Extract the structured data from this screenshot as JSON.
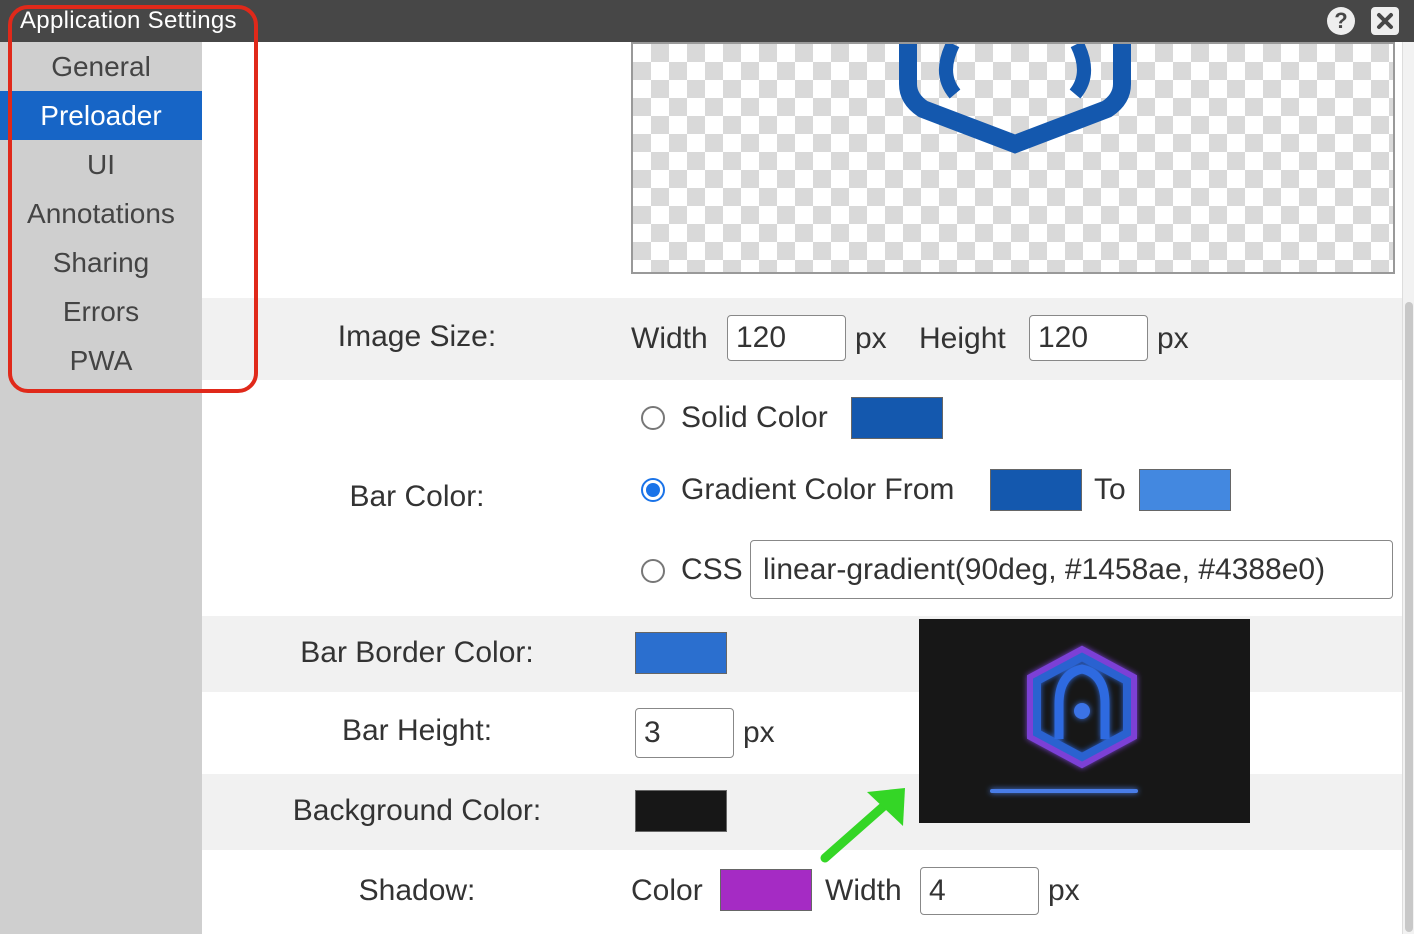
{
  "window": {
    "title": "Application Settings",
    "help_icon": "question-icon",
    "close_icon": "close-icon"
  },
  "sidebar": {
    "items": [
      {
        "label": "General",
        "active": false
      },
      {
        "label": "Preloader",
        "active": true
      },
      {
        "label": "UI",
        "active": false
      },
      {
        "label": "Annotations",
        "active": false
      },
      {
        "label": "Sharing",
        "active": false
      },
      {
        "label": "Errors",
        "active": false
      },
      {
        "label": "PWA",
        "active": false
      }
    ]
  },
  "preloader": {
    "image_size": {
      "label": "Image Size:",
      "width_label": "Width",
      "width_value": "120",
      "height_label": "Height",
      "height_value": "120",
      "unit": "px"
    },
    "bar_color": {
      "label": "Bar Color:",
      "solid_label": "Solid Color",
      "solid_color": "#1458ae",
      "gradient_label": "Gradient Color From",
      "gradient_from": "#1458ae",
      "to_label": "To",
      "gradient_to": "#4388e0",
      "css_label": "CSS",
      "css_value": "linear-gradient(90deg, #1458ae, #4388e0)",
      "selected": "gradient"
    },
    "bar_border_color": {
      "label": "Bar Border Color:",
      "color": "#2b6fcf"
    },
    "bar_height": {
      "label": "Bar Height:",
      "value": "3",
      "unit": "px"
    },
    "background_color": {
      "label": "Background Color:",
      "color": "#171717"
    },
    "shadow": {
      "label": "Shadow:",
      "color_label": "Color",
      "color": "#a52bc4",
      "width_label": "Width",
      "width_value": "4",
      "unit": "px"
    }
  },
  "colors": {
    "accent": "#1765c6",
    "annotation_red": "#e0291a",
    "annotation_green": "#34d626"
  }
}
